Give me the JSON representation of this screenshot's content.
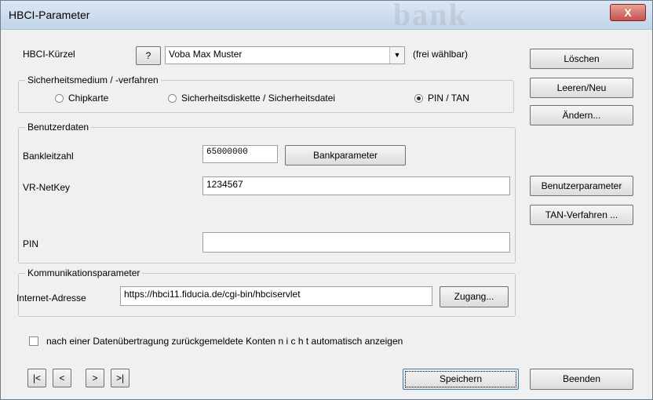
{
  "window": {
    "title": "HBCI-Parameter",
    "close": "X"
  },
  "hbci": {
    "label": "HBCI-Kürzel",
    "help": "?",
    "value": "Voba Max Muster",
    "note": "(frei wählbar)"
  },
  "sicherheit": {
    "legend": "Sicherheitsmedium / -verfahren",
    "options": [
      "Chipkarte",
      "Sicherheitsdiskette / Sicherheitsdatei",
      "PIN / TAN"
    ]
  },
  "benutzer": {
    "legend": "Benutzerdaten",
    "blz_label": "Bankleitzahl",
    "blz_value": "65000000",
    "bankparameter": "Bankparameter",
    "netkey_label": "VR-NetKey",
    "netkey_value": "1234567",
    "pin_label": "PIN",
    "pin_value": ""
  },
  "kommunikation": {
    "legend": "Kommunikationsparameter",
    "address_label": "Internet-Adresse",
    "address_value": "https://hbci11.fiducia.de/cgi-bin/hbciservlet",
    "zugang": "Zugang..."
  },
  "checkbox": {
    "label": "nach einer Datenübertragung zurückgemeldete Konten  n i c h t  automatisch anzeigen"
  },
  "nav": {
    "first": "|<",
    "prev": "<",
    "next": ">",
    "last": ">|"
  },
  "buttons": {
    "loeschen": "Löschen",
    "leeren": "Leeren/Neu",
    "aendern": "Ändern...",
    "benutzerparameter": "Benutzerparameter",
    "tan": "TAN-Verfahren ...",
    "speichern": "Speichern",
    "beenden": "Beenden"
  }
}
